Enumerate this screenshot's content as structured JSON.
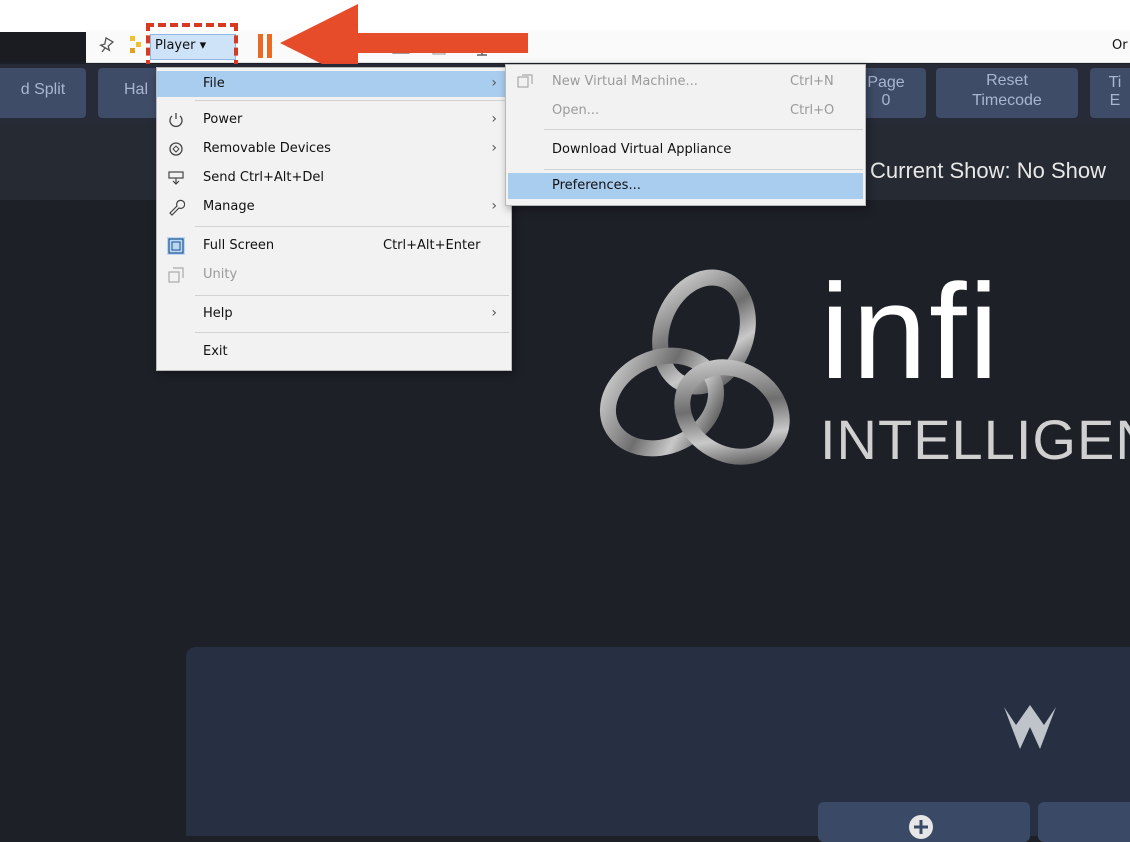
{
  "toolbar": {
    "player_label": "Player ▾",
    "right_text": "Or"
  },
  "stage_buttons": [
    {
      "label": "d Split"
    },
    {
      "label": "Hal"
    },
    {
      "label": "Page"
    },
    {
      "label": "Reset Timecode"
    },
    {
      "label": "Ti"
    }
  ],
  "stage_button_extra": {
    "page_sub": "0",
    "ti_sub": "E"
  },
  "current_show": "Current Show: No Show",
  "logo": {
    "letters": "infi",
    "subtitle": "INTELLIGEN"
  },
  "player_menu": {
    "items": [
      {
        "label": "File",
        "shortcut": "",
        "submenu": true
      },
      {
        "label": "Power",
        "shortcut": "",
        "submenu": true
      },
      {
        "label": "Removable Devices",
        "shortcut": "",
        "submenu": true
      },
      {
        "label": "Send Ctrl+Alt+Del",
        "shortcut": "",
        "submenu": false
      },
      {
        "label": "Manage",
        "shortcut": "",
        "submenu": true
      },
      {
        "label": "Full Screen",
        "shortcut": "Ctrl+Alt+Enter",
        "submenu": false
      },
      {
        "label": "Unity",
        "shortcut": "",
        "submenu": false,
        "disabled": true
      },
      {
        "label": "Help",
        "shortcut": "",
        "submenu": true
      },
      {
        "label": "Exit",
        "shortcut": "",
        "submenu": false
      }
    ]
  },
  "file_menu": {
    "items": [
      {
        "label": "New Virtual Machine...",
        "shortcut": "Ctrl+N"
      },
      {
        "label": "Open...",
        "shortcut": "Ctrl+O"
      },
      {
        "label": "Download Virtual Appliance",
        "shortcut": ""
      },
      {
        "label": "Preferences...",
        "shortcut": ""
      }
    ]
  },
  "colors": {
    "highlight_dash": "#d63a24",
    "arrow": "#e64b2a",
    "menu_highlight": "#a9cdee",
    "background": "#1e2028"
  }
}
